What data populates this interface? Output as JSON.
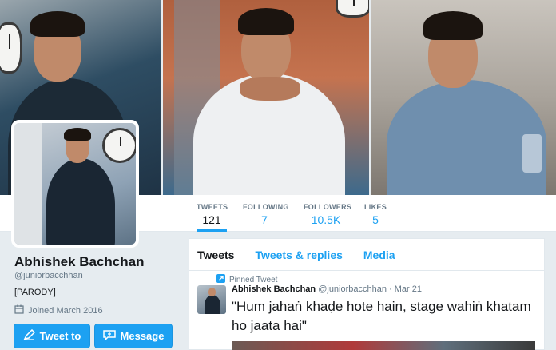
{
  "profile": {
    "name": "Abhishek Bachchan",
    "handle": "@juniorbacchhan",
    "bio": "[PARODY]",
    "joined": "Joined March 2016"
  },
  "stats": [
    {
      "label": "TWEETS",
      "value": "121"
    },
    {
      "label": "FOLLOWING",
      "value": "7"
    },
    {
      "label": "FOLLOWERS",
      "value": "10.5K"
    },
    {
      "label": "LIKES",
      "value": "5"
    }
  ],
  "buttons": {
    "tweet_to": "Tweet to",
    "message": "Message"
  },
  "timeline": {
    "tabs": [
      "Tweets",
      "Tweets & replies",
      "Media"
    ],
    "pinned_label": "Pinned Tweet",
    "tweet": {
      "author": "Abhishek Bachchan",
      "handle": "@juniorbacchhan",
      "date": "· Mar 21",
      "text": "\"Hum jahaṅ khaḍe hote hain, stage wahiṅ khatam ho jaata hai\""
    }
  },
  "icons": {
    "calendar": "calendar-icon",
    "compose": "compose-icon",
    "message": "message-icon",
    "pin": "pin-icon"
  },
  "colors": {
    "accent": "#1da1f2",
    "muted": "#657786",
    "background": "#e6ecf0"
  }
}
